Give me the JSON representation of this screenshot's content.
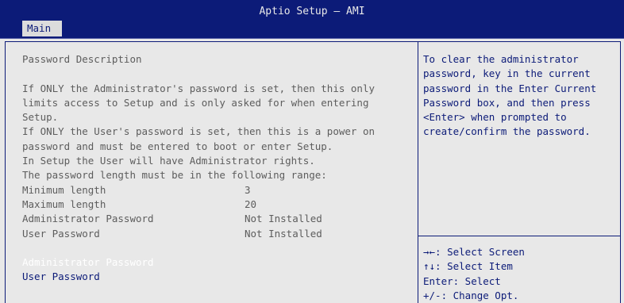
{
  "window": {
    "title": "Aptio Setup – AMI"
  },
  "tabs": [
    {
      "label": "Main"
    }
  ],
  "main": {
    "heading": "Password Description",
    "paragraph": [
      "If ONLY the Administrator's password is set, then this only",
      "limits access to Setup and is only asked for when entering",
      "Setup.",
      "If ONLY the User's password is set, then this is a power on",
      "password and must be entered to boot or enter Setup.",
      "In Setup the User will have Administrator rights.",
      "The password length must be in the following range:"
    ],
    "info_rows": [
      {
        "label": "Minimum length",
        "value": "3"
      },
      {
        "label": "Maximum length",
        "value": "20"
      },
      {
        "label": "Administrator Password",
        "value": "Not Installed"
      },
      {
        "label": "User Password",
        "value": "Not Installed"
      }
    ],
    "menu_items": [
      {
        "label": "Administrator Password",
        "selected": true
      },
      {
        "label": "User Password",
        "selected": false
      }
    ]
  },
  "help": {
    "lines": [
      "To clear the administrator",
      "password, key in the current",
      "password in the Enter Current",
      "Password box, and then press",
      "<Enter> when prompted to",
      "create/confirm the password."
    ]
  },
  "keys": {
    "lines": [
      "→←: Select Screen",
      "↑↓: Select Item",
      "Enter: Select",
      "+/-: Change Opt."
    ]
  },
  "colors": {
    "header_bg": "#0c1b78",
    "body_bg": "#e8e8e8",
    "text_gray": "#5d5d5d",
    "text_blue": "#0c1b78",
    "selected_text": "#ffffff"
  }
}
